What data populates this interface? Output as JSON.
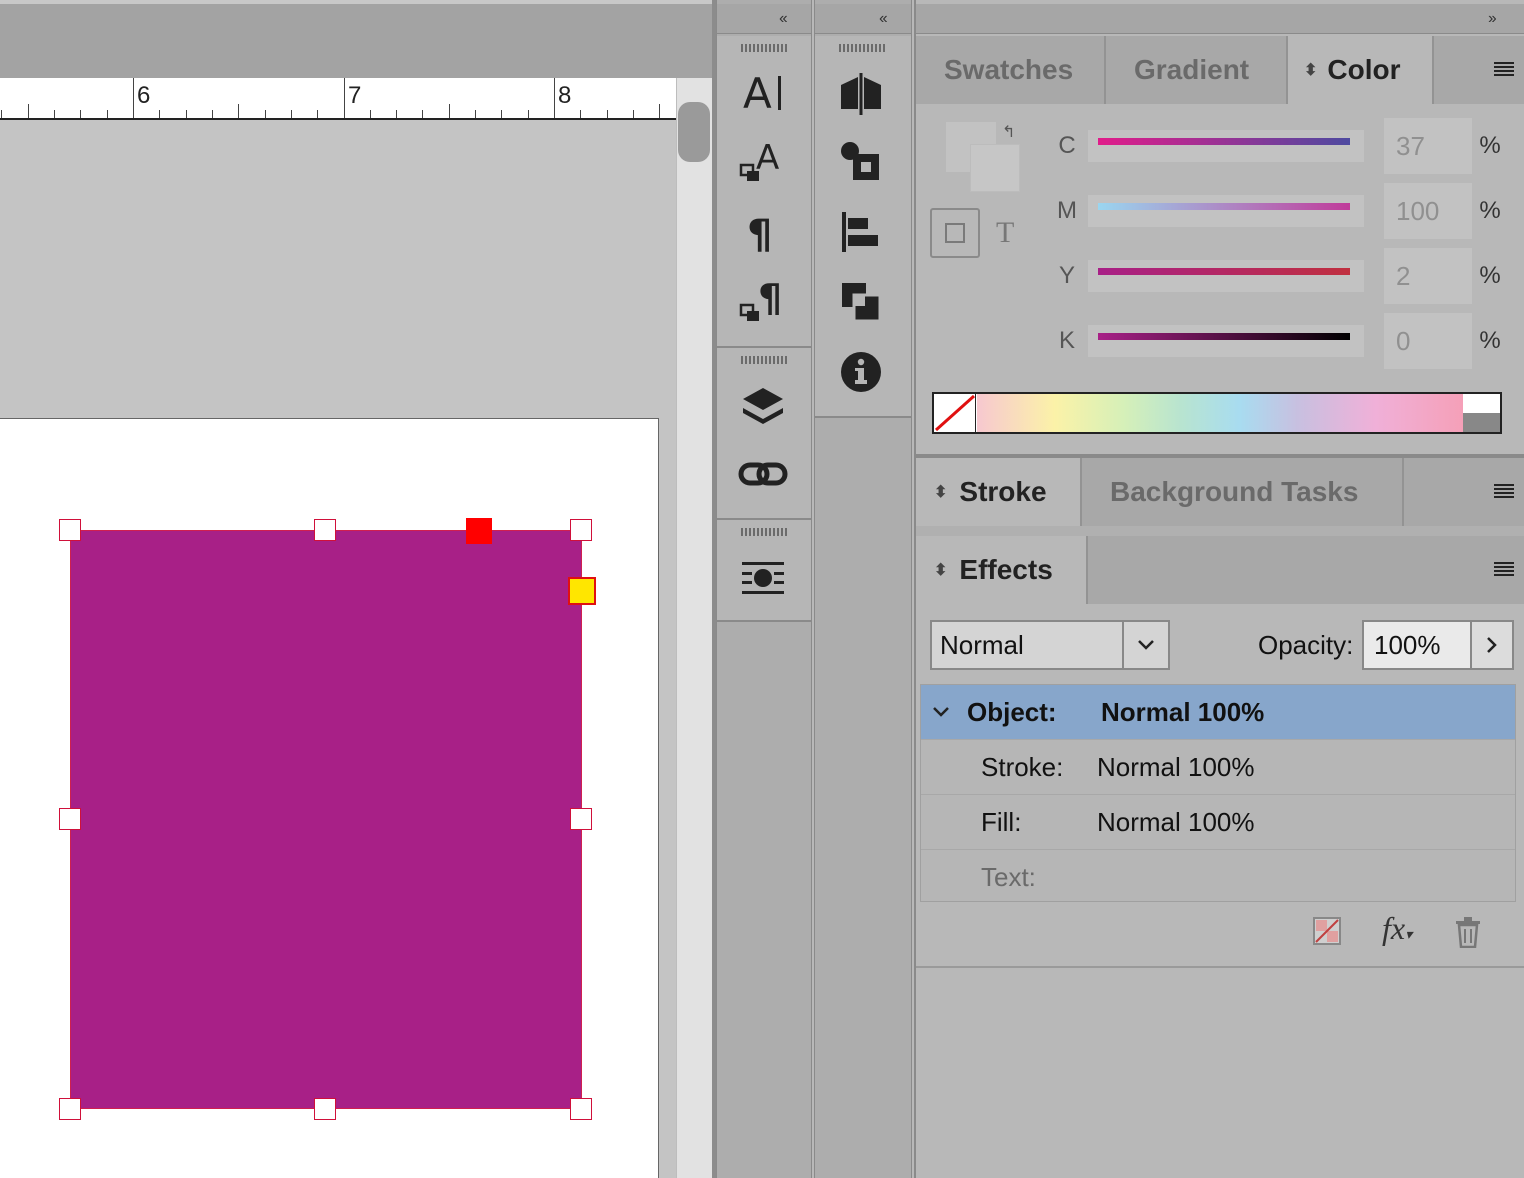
{
  "ruler": {
    "marks": [
      "6",
      "7",
      "8"
    ]
  },
  "panels": {
    "collapse_left_1": "‹‹",
    "collapse_left_2": "‹‹",
    "expand_right": "››"
  },
  "color_panel": {
    "tabs": [
      {
        "label": "Swatches"
      },
      {
        "label": "Gradient"
      },
      {
        "label": "Color"
      }
    ],
    "active_tab": "Color",
    "text_toggle": "T",
    "channels": [
      {
        "label": "C",
        "value": "37",
        "unit": "%"
      },
      {
        "label": "M",
        "value": "100",
        "unit": "%"
      },
      {
        "label": "Y",
        "value": "2",
        "unit": "%"
      },
      {
        "label": "K",
        "value": "0",
        "unit": "%"
      }
    ]
  },
  "stroke_panel": {
    "tabs": [
      {
        "label": "Stroke"
      },
      {
        "label": "Background Tasks"
      }
    ]
  },
  "effects_panel": {
    "tab_label": "Effects",
    "blend_mode": "Normal",
    "opacity_label": "Opacity:",
    "opacity_value": "100%",
    "rows": [
      {
        "label": "Object:",
        "value": "Normal 100%"
      },
      {
        "label": "Stroke:",
        "value": "Normal 100%"
      },
      {
        "label": "Fill:",
        "value": "Normal 100%"
      },
      {
        "label": "Text:",
        "value": ""
      }
    ]
  },
  "colors": {
    "object_fill": "#a82087",
    "selection_border": "#d01f4f",
    "highlight_row": "#87a6cb"
  }
}
